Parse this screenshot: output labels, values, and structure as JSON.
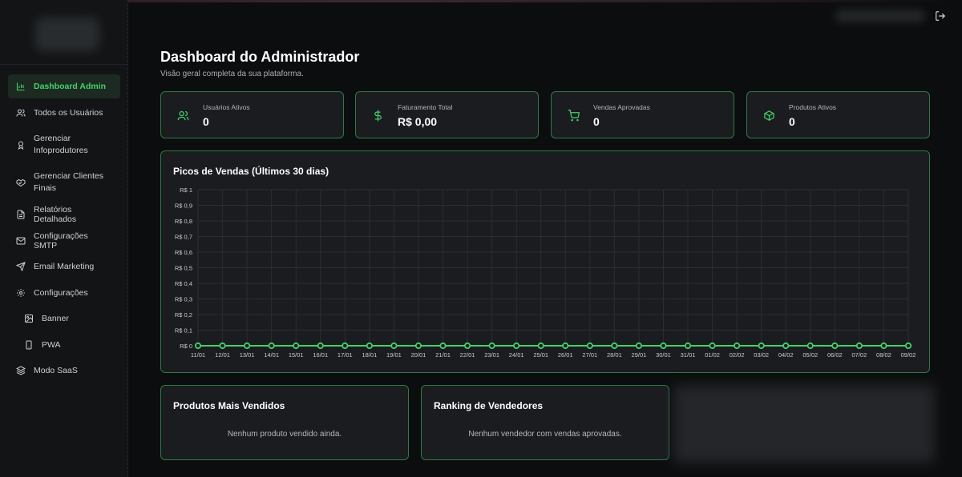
{
  "sidebar": {
    "items": [
      {
        "label": "Dashboard Admin",
        "icon": "bar-chart-icon",
        "active": true
      },
      {
        "label": "Todos os Usuários",
        "icon": "users-icon"
      },
      {
        "label": "Gerenciar Infoprodutores",
        "icon": "award-icon"
      },
      {
        "label": "Gerenciar Clientes Finais",
        "icon": "handshake-icon"
      },
      {
        "label": "Relatórios Detalhados",
        "icon": "file-text-icon"
      },
      {
        "label": "Configurações SMTP",
        "icon": "mail-icon"
      },
      {
        "label": "Email Marketing",
        "icon": "send-icon"
      },
      {
        "label": "Configurações",
        "icon": "gear-icon"
      },
      {
        "label": "Banner",
        "icon": "image-icon"
      },
      {
        "label": "PWA",
        "icon": "smartphone-icon"
      },
      {
        "label": "Modo SaaS",
        "icon": "layers-icon"
      }
    ]
  },
  "header": {
    "title": "Dashboard do Administrador",
    "subtitle": "Visão geral completa da sua plataforma."
  },
  "stats": [
    {
      "label": "Usuários Ativos",
      "value": "0",
      "icon": "users-icon"
    },
    {
      "label": "Faturamento Total",
      "value": "R$ 0,00",
      "icon": "dollar-icon"
    },
    {
      "label": "Vendas Aprovadas",
      "value": "0",
      "icon": "cart-icon"
    },
    {
      "label": "Produtos Ativos",
      "value": "0",
      "icon": "package-icon"
    }
  ],
  "chart_data": {
    "type": "line",
    "title": "Picos de Vendas (Últimos 30 dias)",
    "xlabel": "",
    "ylabel": "",
    "ylim": [
      0,
      1
    ],
    "y_ticks": [
      "R$ 0",
      "R$ 0,1",
      "R$ 0,2",
      "R$ 0,3",
      "R$ 0,4",
      "R$ 0,5",
      "R$ 0,6",
      "R$ 0,7",
      "R$ 0,8",
      "R$ 0,9",
      "R$ 1"
    ],
    "categories": [
      "11/01",
      "12/01",
      "13/01",
      "14/01",
      "15/01",
      "16/01",
      "17/01",
      "18/01",
      "19/01",
      "20/01",
      "21/01",
      "22/01",
      "23/01",
      "24/01",
      "25/01",
      "26/01",
      "27/01",
      "28/01",
      "29/01",
      "30/01",
      "31/01",
      "01/02",
      "02/02",
      "03/02",
      "04/02",
      "05/02",
      "06/02",
      "07/02",
      "08/02",
      "09/02"
    ],
    "values": [
      0,
      0,
      0,
      0,
      0,
      0,
      0,
      0,
      0,
      0,
      0,
      0,
      0,
      0,
      0,
      0,
      0,
      0,
      0,
      0,
      0,
      0,
      0,
      0,
      0,
      0,
      0,
      0,
      0,
      0
    ],
    "grid": true,
    "color": "#43d16b"
  },
  "panels": {
    "top_products": {
      "title": "Produtos Mais Vendidos",
      "empty": "Nenhum produto vendido ainda."
    },
    "ranking": {
      "title": "Ranking de Vendedores",
      "empty": "Nenhum vendedor com vendas aprovadas."
    }
  },
  "colors": {
    "accent": "#43d16b",
    "border": "#2f7a46",
    "card": "#1a1c1f",
    "background": "#0c0d0e"
  }
}
